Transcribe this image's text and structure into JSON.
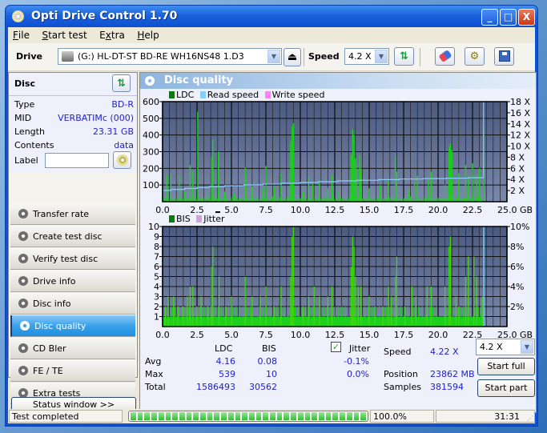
{
  "window": {
    "title": "Opti Drive Control 1.70",
    "controls": [
      "_",
      "□",
      "X"
    ]
  },
  "menu": [
    {
      "label": "File",
      "accel": "F",
      "rest": "ile"
    },
    {
      "label": "Start test",
      "accel": "S",
      "rest": "tart test"
    },
    {
      "label": "Extra",
      "accel_pre": "E",
      "accel": "x",
      "rest": "tra"
    },
    {
      "label": "Help",
      "accel": "H",
      "rest": "elp"
    }
  ],
  "toolbar": {
    "drive_label": "Drive",
    "drive_value": "(G:)  HL-DT-ST BD-RE  WH16NS48 1.D3",
    "speed_label": "Speed",
    "speed_value": "4.2 X",
    "icons": [
      "eject-icon",
      "refresh-icon",
      "erase-icon",
      "settings-icon",
      "save-icon"
    ]
  },
  "disc": {
    "title": "Disc",
    "rows": [
      {
        "key": "Type",
        "value": "BD-R"
      },
      {
        "key": "MID",
        "value": "VERBATIMc (000)"
      },
      {
        "key": "Length",
        "value": "23.31 GB"
      },
      {
        "key": "Contents",
        "value": "data"
      }
    ],
    "label_key": "Label",
    "label_value": ""
  },
  "nav": [
    {
      "label": "Transfer rate",
      "active": false
    },
    {
      "label": "Create test disc",
      "active": false
    },
    {
      "label": "Verify test disc",
      "active": false
    },
    {
      "label": "Drive info",
      "active": false
    },
    {
      "label": "Disc info",
      "active": false
    },
    {
      "label": "Disc quality",
      "active": true
    },
    {
      "label": "CD Bler",
      "active": false
    },
    {
      "label": "FE / TE",
      "active": false
    },
    {
      "label": "Extra tests",
      "active": false
    }
  ],
  "status_window_button": "Status window >>",
  "panel": {
    "title": "Disc quality"
  },
  "chart_data": [
    {
      "type": "bar",
      "title": "LDC",
      "legend": [
        {
          "name": "LDC",
          "color": "#008000"
        },
        {
          "name": "Read speed",
          "color": "#87cefa"
        },
        {
          "name": "Write speed",
          "color": "#ff80ff"
        }
      ],
      "xlabel": "GB",
      "x_ticks": [
        "0.0",
        "2.5",
        "5.0",
        "7.5",
        "10.0",
        "12.5",
        "15.0",
        "17.5",
        "20.0",
        "22.5",
        "25.0 GB"
      ],
      "xlim": [
        0,
        25
      ],
      "y_ticks": [
        "100",
        "200",
        "300",
        "400",
        "500",
        "600"
      ],
      "ylim": [
        0,
        600
      ],
      "y2_ticks": [
        "2 X",
        "4 X",
        "6 X",
        "8 X",
        "10 X",
        "12 X",
        "14 X",
        "16 X",
        "18 X"
      ],
      "y2lim": [
        0,
        18
      ],
      "ldc_peaks": [
        {
          "x": 0.0,
          "y": 80
        },
        {
          "x": 0.3,
          "y": 160
        },
        {
          "x": 0.6,
          "y": 170
        },
        {
          "x": 1.2,
          "y": 160
        },
        {
          "x": 1.6,
          "y": 60
        },
        {
          "x": 2.0,
          "y": 220
        },
        {
          "x": 2.2,
          "y": 180
        },
        {
          "x": 2.55,
          "y": 539
        },
        {
          "x": 3.3,
          "y": 60
        },
        {
          "x": 3.55,
          "y": 270
        },
        {
          "x": 3.65,
          "y": 375
        },
        {
          "x": 4.05,
          "y": 300
        },
        {
          "x": 4.5,
          "y": 60
        },
        {
          "x": 5.2,
          "y": 50
        },
        {
          "x": 6.0,
          "y": 205
        },
        {
          "x": 6.5,
          "y": 90
        },
        {
          "x": 7.3,
          "y": 80
        },
        {
          "x": 7.5,
          "y": 215
        },
        {
          "x": 8.1,
          "y": 90
        },
        {
          "x": 8.6,
          "y": 170
        },
        {
          "x": 9.3,
          "y": 360
        },
        {
          "x": 9.4,
          "y": 450
        },
        {
          "x": 9.5,
          "y": 470
        },
        {
          "x": 10.2,
          "y": 60
        },
        {
          "x": 10.6,
          "y": 150
        },
        {
          "x": 10.9,
          "y": 110
        },
        {
          "x": 11.4,
          "y": 130
        },
        {
          "x": 12.0,
          "y": 80
        },
        {
          "x": 12.3,
          "y": 160
        },
        {
          "x": 12.8,
          "y": 70
        },
        {
          "x": 13.7,
          "y": 280
        },
        {
          "x": 13.8,
          "y": 435
        },
        {
          "x": 13.9,
          "y": 400
        },
        {
          "x": 14.0,
          "y": 260
        },
        {
          "x": 14.1,
          "y": 200
        },
        {
          "x": 14.3,
          "y": 280
        },
        {
          "x": 14.4,
          "y": 200
        },
        {
          "x": 15.0,
          "y": 80
        },
        {
          "x": 15.8,
          "y": 100
        },
        {
          "x": 16.4,
          "y": 130
        },
        {
          "x": 16.9,
          "y": 280
        },
        {
          "x": 17.0,
          "y": 180
        },
        {
          "x": 17.9,
          "y": 70
        },
        {
          "x": 18.3,
          "y": 120
        },
        {
          "x": 18.5,
          "y": 155
        },
        {
          "x": 19.3,
          "y": 130
        },
        {
          "x": 19.5,
          "y": 180
        },
        {
          "x": 20.5,
          "y": 100
        },
        {
          "x": 20.8,
          "y": 330
        },
        {
          "x": 20.9,
          "y": 350
        },
        {
          "x": 21.0,
          "y": 310
        },
        {
          "x": 21.5,
          "y": 170
        },
        {
          "x": 22.0,
          "y": 220
        },
        {
          "x": 22.2,
          "y": 160
        },
        {
          "x": 22.5,
          "y": 230
        },
        {
          "x": 22.8,
          "y": 160
        },
        {
          "x": 23.0,
          "y": 200
        },
        {
          "x": 23.3,
          "y": 440
        }
      ],
      "read_speed": [
        {
          "x": 0.0,
          "y": 2.02
        },
        {
          "x": 0.6,
          "y": 2.2
        },
        {
          "x": 1.6,
          "y": 2.38
        },
        {
          "x": 2.5,
          "y": 2.55
        },
        {
          "x": 3.4,
          "y": 2.72
        },
        {
          "x": 4.5,
          "y": 2.88
        },
        {
          "x": 5.9,
          "y": 3.02
        },
        {
          "x": 7.3,
          "y": 3.18
        },
        {
          "x": 8.6,
          "y": 3.33
        },
        {
          "x": 10.0,
          "y": 3.46
        },
        {
          "x": 11.3,
          "y": 3.6
        },
        {
          "x": 12.7,
          "y": 3.74
        },
        {
          "x": 14.1,
          "y": 3.86
        },
        {
          "x": 15.7,
          "y": 3.98
        },
        {
          "x": 17.2,
          "y": 4.08
        },
        {
          "x": 18.9,
          "y": 4.16
        },
        {
          "x": 20.6,
          "y": 4.23
        },
        {
          "x": 22.2,
          "y": 4.3
        },
        {
          "x": 23.3,
          "y": 18.0
        }
      ]
    },
    {
      "type": "bar",
      "title": "BIS",
      "legend": [
        {
          "name": "BIS",
          "color": "#008000"
        },
        {
          "name": "Jitter",
          "color": "#d8a0d8"
        }
      ],
      "xlabel": "GB",
      "x_ticks": [
        "0.0",
        "2.5",
        "5.0",
        "7.5",
        "10.0",
        "12.5",
        "15.0",
        "17.5",
        "20.0",
        "22.5",
        "25.0 GB"
      ],
      "xlim": [
        0,
        25
      ],
      "y_ticks": [
        "1",
        "2",
        "3",
        "4",
        "5",
        "6",
        "7",
        "8",
        "9",
        "10"
      ],
      "ylim": [
        0,
        10
      ],
      "y2_ticks": [
        "2%",
        "4%",
        "6%",
        "8%",
        "10%"
      ],
      "y2lim": [
        0,
        10
      ],
      "bis_baseline": 1,
      "bis_peaks": [
        {
          "x": 0.2,
          "y": 2
        },
        {
          "x": 0.4,
          "y": 3
        },
        {
          "x": 0.8,
          "y": 3
        },
        {
          "x": 1.1,
          "y": 2
        },
        {
          "x": 1.5,
          "y": 2
        },
        {
          "x": 1.8,
          "y": 3
        },
        {
          "x": 2.0,
          "y": 4
        },
        {
          "x": 2.2,
          "y": 4
        },
        {
          "x": 2.5,
          "y": 2
        },
        {
          "x": 2.8,
          "y": 3
        },
        {
          "x": 3.3,
          "y": 2
        },
        {
          "x": 3.55,
          "y": 6
        },
        {
          "x": 3.65,
          "y": 8
        },
        {
          "x": 4.1,
          "y": 5
        },
        {
          "x": 4.6,
          "y": 2
        },
        {
          "x": 5.0,
          "y": 3
        },
        {
          "x": 6.0,
          "y": 5
        },
        {
          "x": 6.5,
          "y": 3
        },
        {
          "x": 7.1,
          "y": 3
        },
        {
          "x": 7.5,
          "y": 4
        },
        {
          "x": 8.1,
          "y": 2
        },
        {
          "x": 8.6,
          "y": 4
        },
        {
          "x": 9.3,
          "y": 5
        },
        {
          "x": 9.4,
          "y": 9
        },
        {
          "x": 9.5,
          "y": 10
        },
        {
          "x": 10.2,
          "y": 2
        },
        {
          "x": 10.6,
          "y": 3
        },
        {
          "x": 11.0,
          "y": 4
        },
        {
          "x": 11.4,
          "y": 3
        },
        {
          "x": 12.0,
          "y": 3
        },
        {
          "x": 12.3,
          "y": 4
        },
        {
          "x": 13.7,
          "y": 6
        },
        {
          "x": 13.8,
          "y": 9
        },
        {
          "x": 13.9,
          "y": 8
        },
        {
          "x": 14.0,
          "y": 5
        },
        {
          "x": 14.2,
          "y": 4
        },
        {
          "x": 14.4,
          "y": 4
        },
        {
          "x": 15.0,
          "y": 3
        },
        {
          "x": 15.4,
          "y": 2
        },
        {
          "x": 16.0,
          "y": 2
        },
        {
          "x": 16.4,
          "y": 4
        },
        {
          "x": 16.6,
          "y": 3
        },
        {
          "x": 16.9,
          "y": 5
        },
        {
          "x": 17.0,
          "y": 7
        },
        {
          "x": 17.6,
          "y": 2
        },
        {
          "x": 18.1,
          "y": 4
        },
        {
          "x": 18.4,
          "y": 3
        },
        {
          "x": 19.2,
          "y": 4
        },
        {
          "x": 19.5,
          "y": 4
        },
        {
          "x": 20.5,
          "y": 4
        },
        {
          "x": 20.8,
          "y": 8
        },
        {
          "x": 20.9,
          "y": 9
        },
        {
          "x": 21.3,
          "y": 3
        },
        {
          "x": 21.5,
          "y": 2
        },
        {
          "x": 22.0,
          "y": 5
        },
        {
          "x": 22.2,
          "y": 7
        },
        {
          "x": 22.6,
          "y": 7
        },
        {
          "x": 22.8,
          "y": 5
        },
        {
          "x": 23.2,
          "y": 3
        },
        {
          "x": 23.3,
          "y": 10
        }
      ]
    }
  ],
  "stats": {
    "col_ldc": "LDC",
    "col_bis": "BIS",
    "jitter_checked": true,
    "jitter_label": "Jitter",
    "rows": [
      {
        "label": "Avg",
        "ldc": "4.16",
        "bis": "0.08",
        "jitter": "-0.1%"
      },
      {
        "label": "Max",
        "ldc": "539",
        "bis": "10",
        "jitter": "0.0%"
      },
      {
        "label": "Total",
        "ldc": "1586493",
        "bis": "30562",
        "jitter": ""
      }
    ],
    "speed_label": "Speed",
    "speed_value": "4.22 X",
    "speed_select": "4.2 X",
    "position_label": "Position",
    "position_value": "23862 MB",
    "samples_label": "Samples",
    "samples_value": "381594",
    "start_full": "Start full",
    "start_part": "Start part"
  },
  "statusbar": {
    "text": "Test completed",
    "progress": 1.0,
    "progress_text": "100.0%",
    "time": "31:31"
  }
}
